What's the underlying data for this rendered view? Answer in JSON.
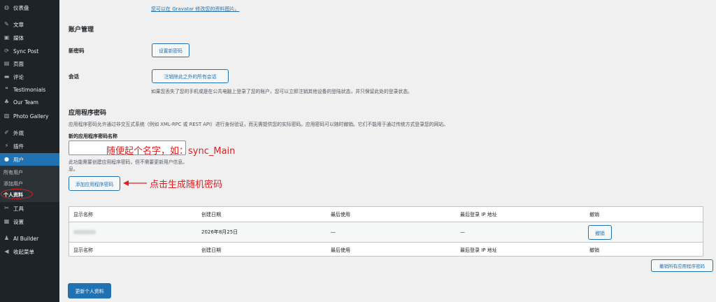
{
  "sidebar": {
    "items": [
      {
        "label": "仪表盘",
        "icon": "dashboard-icon",
        "glyph": "◍"
      },
      {
        "label": "文章",
        "icon": "pin-icon",
        "glyph": "✎"
      },
      {
        "label": "媒体",
        "icon": "media-icon",
        "glyph": "▣"
      },
      {
        "label": "Sync Post",
        "icon": "sync-icon",
        "glyph": "⟳"
      },
      {
        "label": "页面",
        "icon": "page-icon",
        "glyph": "▤"
      },
      {
        "label": "评论",
        "icon": "comment-icon",
        "glyph": "▬"
      },
      {
        "label": "Testimonials",
        "icon": "quote-icon",
        "glyph": "❝"
      },
      {
        "label": "Our Team",
        "icon": "team-icon",
        "glyph": "♣"
      },
      {
        "label": "Photo Gallery",
        "icon": "gallery-icon",
        "glyph": "▨"
      },
      {
        "label": "外观",
        "icon": "appearance-icon",
        "glyph": "✐"
      },
      {
        "label": "插件",
        "icon": "plugin-icon",
        "glyph": "⚡"
      },
      {
        "label": "用户",
        "icon": "user-icon",
        "glyph": "●"
      },
      {
        "label": "工具",
        "icon": "tools-icon",
        "glyph": "✂"
      },
      {
        "label": "设置",
        "icon": "settings-icon",
        "glyph": "▦"
      },
      {
        "label": "AI Builder",
        "icon": "ai-icon",
        "glyph": "♟"
      },
      {
        "label": "收起菜单",
        "icon": "collapse-icon",
        "glyph": "◀"
      }
    ],
    "submenu": [
      "所有用户",
      "添加用户",
      "个人资料"
    ]
  },
  "gravatar_link": "您可以在 Gravatar 修改您的资料图片。",
  "account": {
    "heading": "账户管理",
    "new_password_label": "新密码",
    "set_password_button": "设置新密码",
    "sessions_label": "会话",
    "logout_others_button": "注销除此之外的所有会话",
    "sessions_desc": "如果您丢失了您的手机或是在公共电脑上登录了您的账户，您可以立即注销其他设备的登陆状态，并只保留此处的登录状态。"
  },
  "app_passwords": {
    "heading": "应用程序密码",
    "desc": "应用程序密码允许通过非交互式系统（例如 XML-RPC 或 REST API）进行身份验证，而无需提供您的实际密码。应用密码可以随时撤销。它们不能用于通过传统方式登录您的网站。",
    "new_name_label": "新的应用程序密码名称",
    "new_name_value": "",
    "field_desc_1": "此功能需要创建应用程序密码，但不需要更新用户信息。",
    "field_desc_2": "息。",
    "add_button": "添加应用程序密码",
    "table": {
      "columns": [
        "显示名称",
        "创建日期",
        "最后使用",
        "最后登录 IP 地址",
        "撤销"
      ],
      "rows": [
        {
          "name": "",
          "created": "2026年8月25日",
          "last_used": "—",
          "last_ip": "—",
          "revoke": "撤销"
        }
      ]
    },
    "revoke_all_button": "撤销所有应用程序密码"
  },
  "update_profile_button": "更新个人资料",
  "annotations": {
    "name_hint": "随便起个名字，如：sync_Main",
    "click_hint": "点击生成随机密码",
    "color": "#e0201f"
  },
  "colors": {
    "sidebar_bg": "#1d2327",
    "accent": "#2271b1",
    "page_bg": "#f0f0f1"
  }
}
